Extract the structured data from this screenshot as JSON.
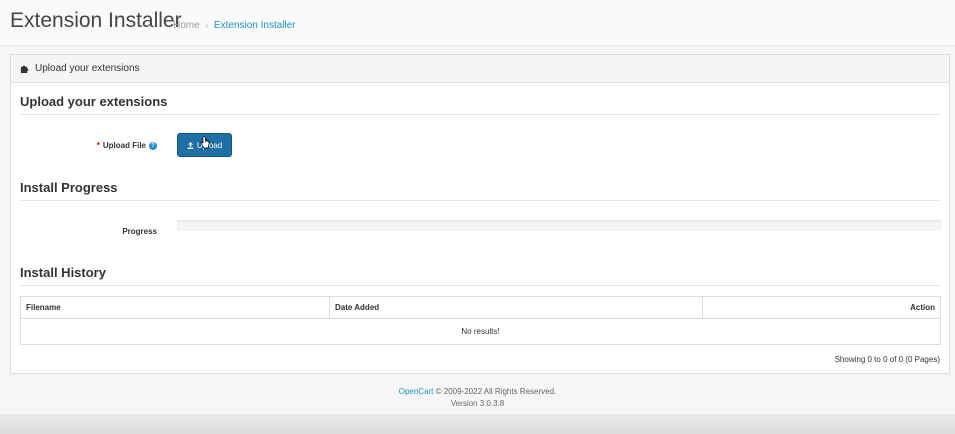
{
  "header": {
    "title": "Extension Installer",
    "breadcrumb": [
      {
        "label": "Home"
      },
      {
        "label": "Extension Installer"
      }
    ],
    "breadcrumb_separator": "›"
  },
  "panel": {
    "heading": "Upload your extensions",
    "heading_icon": "puzzle-icon"
  },
  "upload_section": {
    "title": "Upload your extensions",
    "field_label": "Upload File",
    "required_mark": "*",
    "help_icon": "question-circle-icon",
    "help_glyph": "?",
    "button_label": "Upload",
    "button_icon": "upload-icon"
  },
  "progress_section": {
    "title": "Install Progress",
    "label": "Progress",
    "value": 0
  },
  "history_section": {
    "title": "Install History",
    "columns": [
      "Filename",
      "Date Added",
      "Action"
    ],
    "empty_text": "No results!",
    "pagination_text": "Showing 0 to 0 of 0 (0 Pages)"
  },
  "footer": {
    "brand": "OpenCart",
    "copyright": "© 2009-2022 All Rights Reserved.",
    "version": "Version 3.0.3.8"
  },
  "colors": {
    "accent": "#1e91cf",
    "button": "#1f6fa7",
    "required": "#cc0000"
  }
}
